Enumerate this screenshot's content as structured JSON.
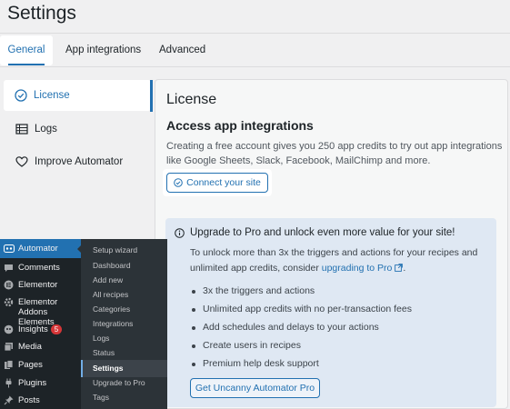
{
  "page": {
    "title": "Settings"
  },
  "tabs": [
    {
      "label": "General",
      "active": true
    },
    {
      "label": "App integrations",
      "active": false
    },
    {
      "label": "Advanced",
      "active": false
    }
  ],
  "sidebar": {
    "items": [
      {
        "label": "License",
        "icon": "check-circle-icon",
        "active": true
      },
      {
        "label": "Logs",
        "icon": "table-icon",
        "active": false
      },
      {
        "label": "Improve Automator",
        "icon": "heart-icon",
        "active": false
      }
    ]
  },
  "license": {
    "title": "License",
    "subtitle": "Access app integrations",
    "description": "Creating a free account gives you 250 app credits to try out app integrations like Google Sheets, Slack, Facebook, MailChimp and more.",
    "connect_label": "Connect your site"
  },
  "upgrade": {
    "title": "Upgrade to Pro and unlock even more value for your site!",
    "desc_prefix": "To unlock more than 3x the triggers and actions for your recipes and unlimited app credits, consider ",
    "desc_link": "upgrading to Pro",
    "desc_suffix": ".",
    "features": [
      "3x the triggers and actions",
      "Unlimited app credits with no per-transaction fees",
      "Add schedules and delays to your actions",
      "Create users in recipes",
      "Premium help desk support"
    ],
    "cta_label": "Get Uncanny Automator Pro"
  },
  "wp_menu": {
    "items": [
      {
        "label": "Automator",
        "icon": "automator-icon",
        "active": true
      },
      {
        "label": "Comments",
        "icon": "comment-icon"
      },
      {
        "label": "Elementor",
        "icon": "elementor-icon"
      },
      {
        "label": "Elementor Addons Elements",
        "icon": "gear-icon"
      },
      {
        "label": "Insights",
        "icon": "insights-icon",
        "badge": "5"
      },
      {
        "label": "Media",
        "icon": "media-icon"
      },
      {
        "label": "Pages",
        "icon": "page-icon"
      },
      {
        "label": "Plugins",
        "icon": "plugin-icon"
      },
      {
        "label": "Posts",
        "icon": "pin-icon"
      }
    ],
    "submenu": [
      "Setup wizard",
      "Dashboard",
      "Add new",
      "All recipes",
      "Categories",
      "Integrations",
      "Logs",
      "Status",
      "Settings",
      "Upgrade to Pro",
      "Tags"
    ],
    "submenu_current": "Settings"
  }
}
